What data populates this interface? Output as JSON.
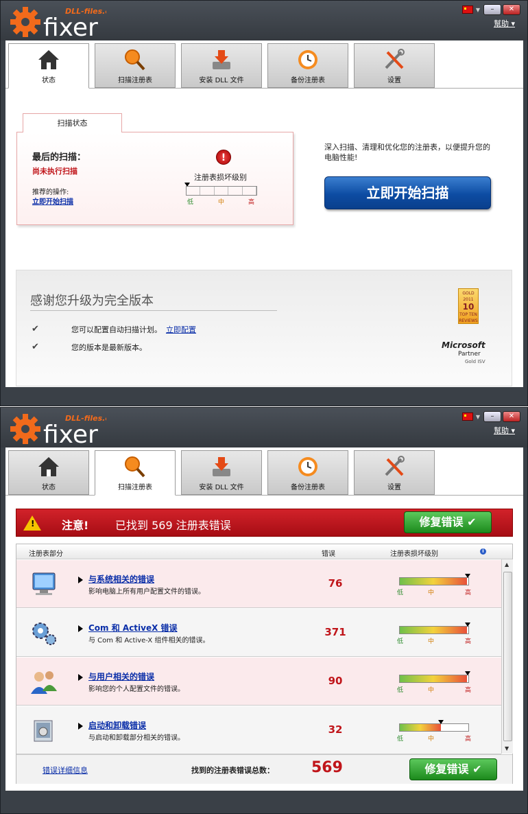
{
  "app": {
    "logo_brand": "DLL-files.com",
    "logo_name": "fixer",
    "help_label": "幫助",
    "minimize": "–",
    "close": "✕",
    "colors": {
      "accent_blue": "#0d4ca3",
      "alert_red": "#c0151a",
      "fix_green": "#1c8a1c",
      "chrome": "#3a4047"
    }
  },
  "tabs": [
    {
      "label": "状态",
      "icon": "home-icon"
    },
    {
      "label": "扫描注册表",
      "icon": "magnifier-icon"
    },
    {
      "label": "安装 DLL 文件",
      "icon": "install-icon"
    },
    {
      "label": "备份注册表",
      "icon": "clock-backup-icon"
    },
    {
      "label": "设置",
      "icon": "tools-icon"
    }
  ],
  "status": {
    "panel_tab": "扫描状态",
    "last_scan_label": "最后的扫描：",
    "last_scan_value": "尚未执行扫描",
    "recommended_label": "推荐的操作:",
    "recommended_link": "立即开始扫描",
    "damage_label": "注册表损坏级别",
    "levels": {
      "low": "低",
      "mid": "中",
      "high": "高"
    },
    "description": "深入扫描、清理和优化您的注册表，以便提升您的电脑性能!",
    "scan_button": "立即开始扫描",
    "alert_glyph": "!"
  },
  "upgrade": {
    "heading": "感谢您升级为完全版本",
    "check": "✔",
    "feature1": "您可以配置自动扫描计划。",
    "feature1_link": "立即配置",
    "feature2": "您的版本是最新版本。",
    "award_lines": [
      "GOLD",
      "2011",
      "10",
      "TOP TEN",
      "REVIEWS"
    ],
    "partner_line1": "Microsoft",
    "partner_line2": "Partner",
    "partner_line3": "Gold ISV"
  },
  "scan": {
    "attention": "注意!",
    "found_text": "已找到  569 注册表错误",
    "fix_button": "修复错误 ✔",
    "columns": {
      "section": "注册表部分",
      "errors": "错误",
      "damage": "注册表损坏级别",
      "info": "i"
    },
    "levels": {
      "low": "低",
      "mid": "中",
      "high": "高"
    },
    "rows": [
      {
        "title": "与系统相关的错误",
        "desc": "影响电脑上所有用户配置文件的错误。",
        "count": "76",
        "level": 0.98,
        "icon": "computer-icon"
      },
      {
        "title": "Com 和 ActiveX 错误",
        "desc": "与 Com 和 Active-X 组件相关的错误。",
        "count": "371",
        "level": 0.98,
        "icon": "gears-icon"
      },
      {
        "title": "与用户相关的错误",
        "desc": "影响您的个人配置文件的错误。",
        "count": "90",
        "level": 0.98,
        "icon": "users-icon"
      },
      {
        "title": "启动和卸载错误",
        "desc": "与启动和卸载部分相关的错误。",
        "count": "32",
        "level": 0.6,
        "icon": "installer-box-icon"
      }
    ],
    "details_link": "错误详细信息",
    "total_label": "找到的注册表错误总数：",
    "total": "569"
  }
}
